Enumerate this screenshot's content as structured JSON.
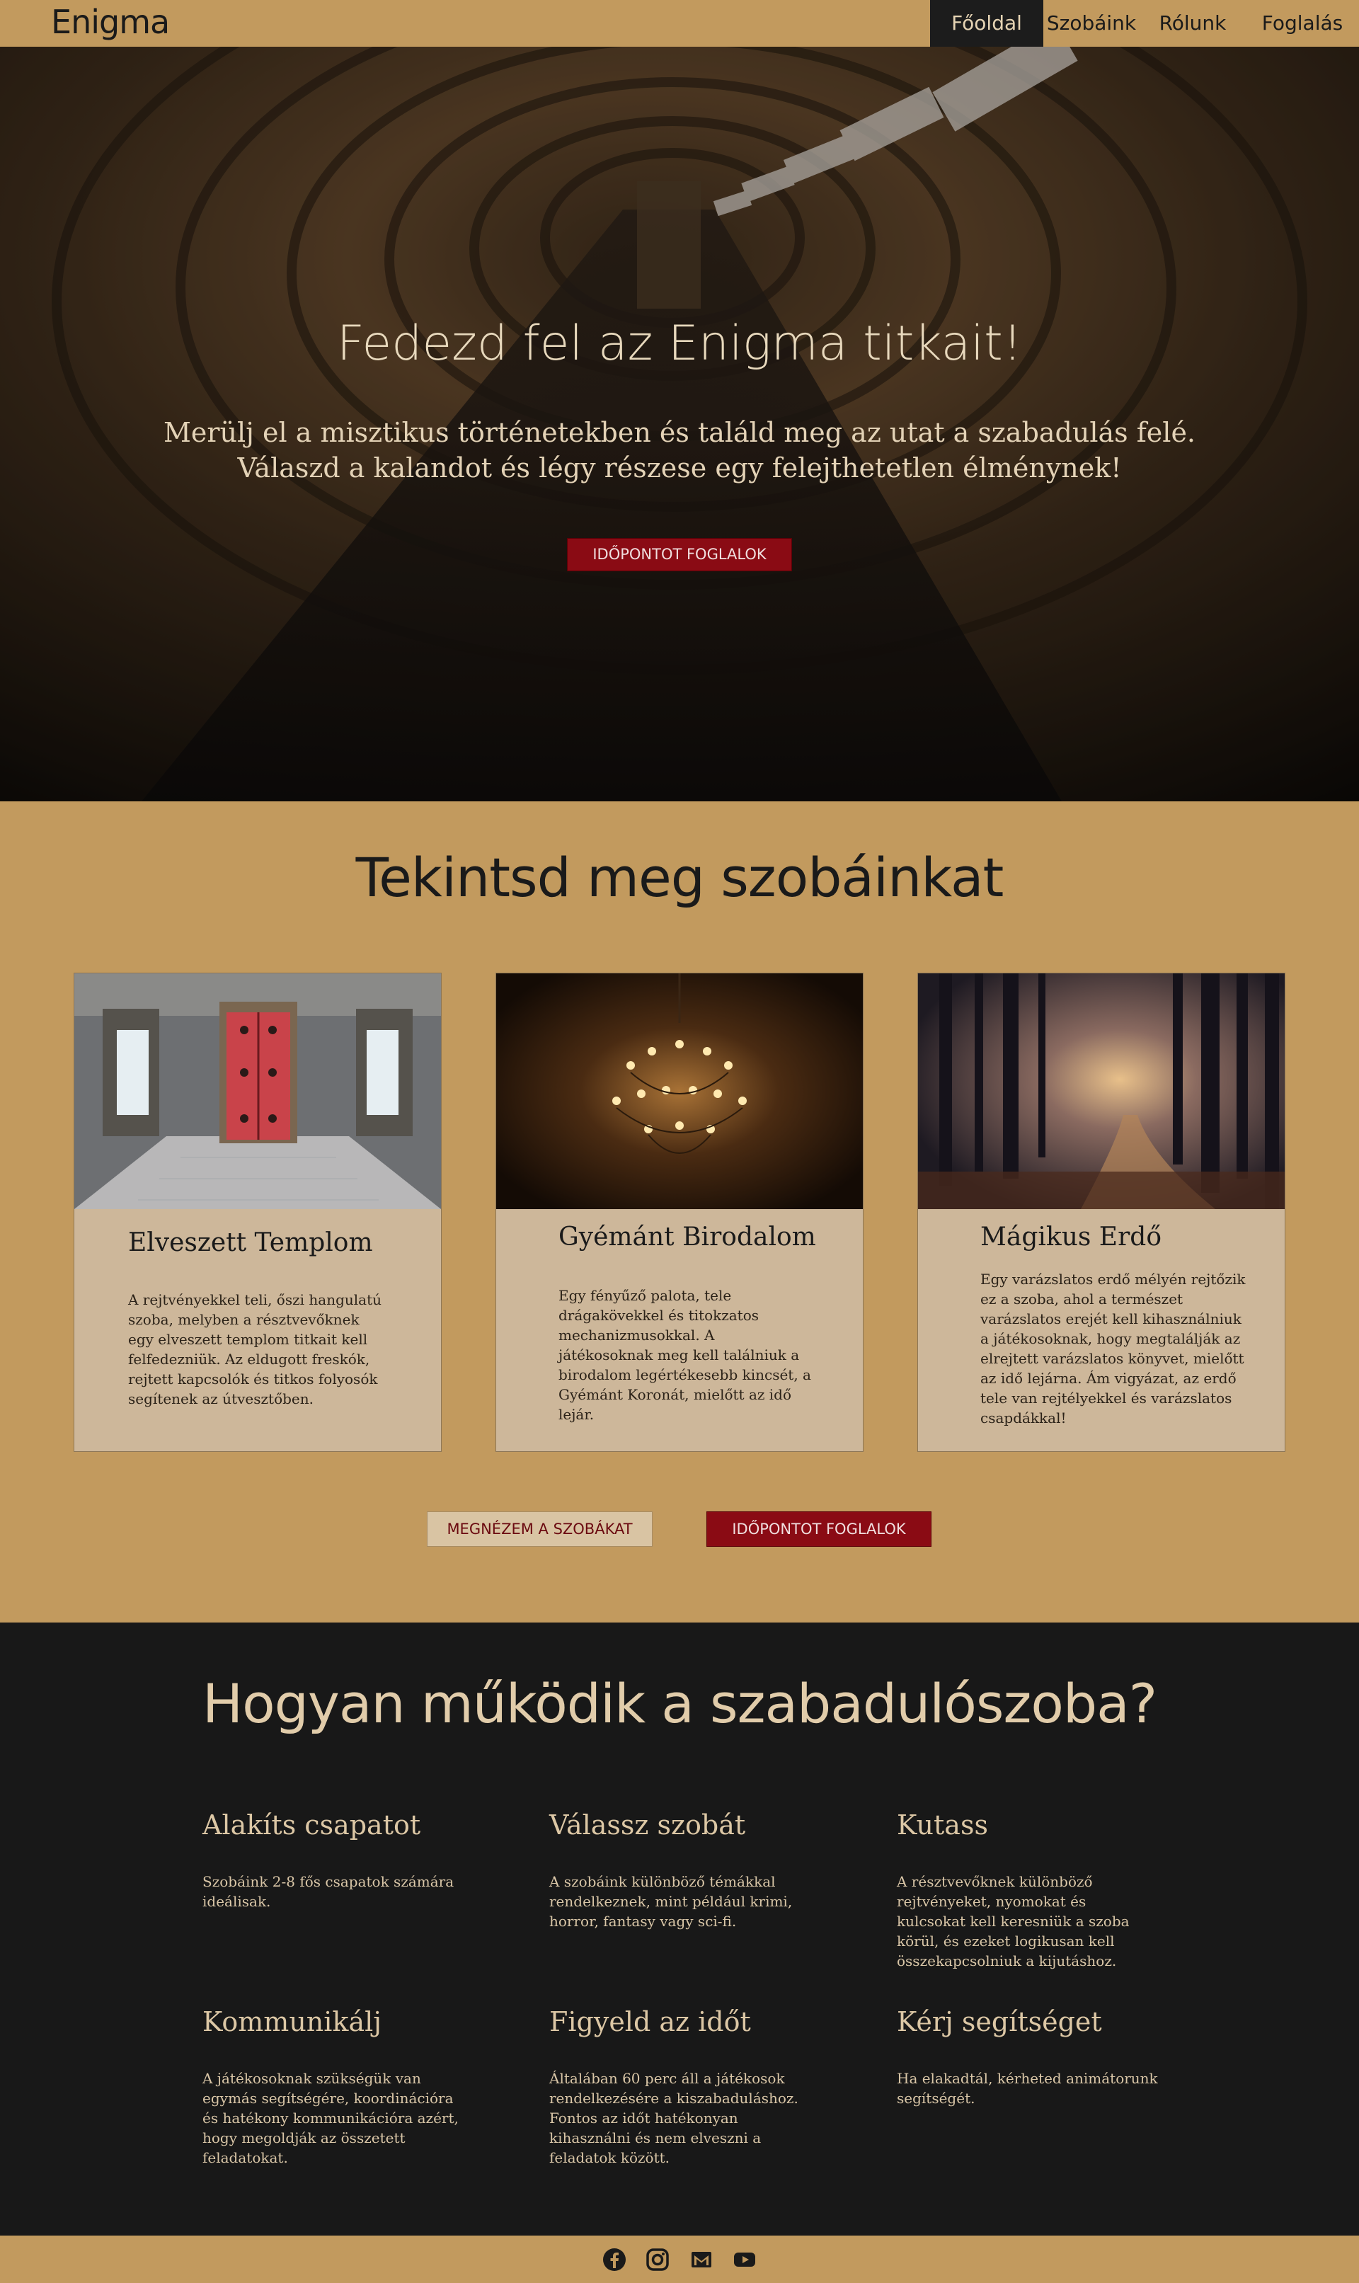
{
  "nav": {
    "brand": "Enigma",
    "links": [
      {
        "label": "Főoldal",
        "active": true
      },
      {
        "label": "Szobáink",
        "active": false
      },
      {
        "label": "Rólunk",
        "active": false
      },
      {
        "label": "Foglalás",
        "active": false
      }
    ]
  },
  "hero": {
    "title": "Fedezd fel az Enigma titkait!",
    "text": "Merülj el a misztikus történetekben és találd meg az utat a szabadulás felé. Válaszd a kalandot és légy részese egy felejthetetlen élménynek!",
    "button": "IDŐPONTOT FOGLALOK"
  },
  "rooms": {
    "title": "Tekintsd meg szobáinkat",
    "cards": [
      {
        "title": "Elveszett Templom",
        "desc": "A rejtvényekkel teli, őszi hangulatú szoba, melyben a résztvevőknek egy elveszett templom titkait kell felfedezniük. Az eldugott freskók, rejtett kapcsolók és titkos folyosók segítenek az útvesztőben."
      },
      {
        "title": "Gyémánt Birodalom",
        "desc": "Egy fényűző palota, tele drágakövekkel és titokzatos mechanizmusokkal. A játékosoknak meg kell találniuk a birodalom legértékesebb kincsét, a Gyémánt Koronát, mielőtt az idő lejár."
      },
      {
        "title": "Mágikus Erdő",
        "desc": "Egy varázslatos erdő mélyén rejtőzik ez a szoba, ahol a természet varázslatos erejét kell kihasználniuk a játékosoknak, hogy megtalálják az elrejtett varázslatos könyvet, mielőtt az idő lejárna. Ám vigyázat, az erdő tele van rejtélyekkel és varázslatos csapdákkal!"
      }
    ],
    "btn_rooms": "MEGNÉZEM A SZOBÁKAT",
    "btn_book": "IDŐPONTOT FOGLALOK"
  },
  "how": {
    "title": "Hogyan működik a szabadulószoba?",
    "steps": [
      {
        "title": "Alakíts csapatot",
        "text": "Szobáink 2-8 fős csapatok számára ideálisak."
      },
      {
        "title": "Válassz szobát",
        "text": "A szobáink különböző témákkal rendelkeznek, mint például krimi, horror, fantasy vagy sci-fi."
      },
      {
        "title": "Kutass",
        "text": "A résztvevőknek különböző rejtvényeket, nyomokat és kulcsokat kell keresniük a szoba körül, és ezeket logikusan kell összekapcsolniuk a kijutáshoz."
      },
      {
        "title": "Kommunikálj",
        "text": "A játékosoknak szükségük van egymás segítségére, koordinációra és hatékony kommunikációra azért, hogy megoldják az összetett feladatokat."
      },
      {
        "title": "Figyeld az időt",
        "text": "Általában 60 perc áll a játékosok rendelkezésére a kiszabaduláshoz. Fontos az időt hatékonyan kihasználni és nem elveszni a feladatok között."
      },
      {
        "title": "Kérj segítséget",
        "text": "Ha elakadtál, kérheted animátorunk segítségét."
      }
    ]
  },
  "footer": {
    "icons": [
      "facebook-icon",
      "instagram-icon",
      "gmail-icon",
      "youtube-icon"
    ]
  },
  "colors": {
    "gold": "#c29a5e",
    "dark": "#181818",
    "crimson": "#8a0b14",
    "card": "#cdb79a"
  }
}
